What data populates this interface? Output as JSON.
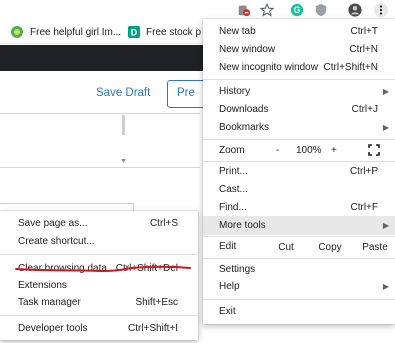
{
  "browser": {
    "bookmarks": [
      {
        "label": "Free helpful girl Im...",
        "icon": "site-favicon-icon"
      },
      {
        "label": "Free stock p",
        "icon": "site-favicon-icon"
      }
    ],
    "extension_icons": [
      "adblock-extension-icon",
      "star-icon",
      "grammarly-icon",
      "shield-extension-icon",
      "profile-avatar-icon",
      "three-dot-menu-icon"
    ]
  },
  "page": {
    "save_draft": "Save Draft",
    "preview": "Pre"
  },
  "main_menu": {
    "new_tab": {
      "label": "New tab",
      "shortcut": "Ctrl+T"
    },
    "new_window": {
      "label": "New window",
      "shortcut": "Ctrl+N"
    },
    "new_incognito": {
      "label": "New incognito window",
      "shortcut": "Ctrl+Shift+N"
    },
    "history": {
      "label": "History"
    },
    "downloads": {
      "label": "Downloads",
      "shortcut": "Ctrl+J"
    },
    "bookmarks": {
      "label": "Bookmarks"
    },
    "zoom": {
      "label": "Zoom",
      "minus": "-",
      "value": "100%",
      "plus": "+"
    },
    "print": {
      "label": "Print...",
      "shortcut": "Ctrl+P"
    },
    "cast": {
      "label": "Cast..."
    },
    "find": {
      "label": "Find...",
      "shortcut": "Ctrl+F"
    },
    "more_tools": {
      "label": "More tools"
    },
    "edit": {
      "label": "Edit",
      "cut": "Cut",
      "copy": "Copy",
      "paste": "Paste"
    },
    "settings": {
      "label": "Settings"
    },
    "help": {
      "label": "Help"
    },
    "exit": {
      "label": "Exit"
    }
  },
  "more_tools_menu": {
    "save_page": {
      "label": "Save page as...",
      "shortcut": "Ctrl+S"
    },
    "create_shortcut": {
      "label": "Create shortcut..."
    },
    "clear_browsing": {
      "label": "Clear browsing data...",
      "shortcut": "Ctrl+Shift+Del"
    },
    "extensions": {
      "label": "Extensions"
    },
    "task_manager": {
      "label": "Task manager",
      "shortcut": "Shift+Esc"
    },
    "developer_tools": {
      "label": "Developer tools",
      "shortcut": "Ctrl+Shift+I"
    }
  },
  "colors": {
    "accent_blue": "#2e76c2",
    "header_dark": "#1f2124",
    "annotation_red": "#d8151b",
    "menu_highlight": "#e8e8e8"
  }
}
